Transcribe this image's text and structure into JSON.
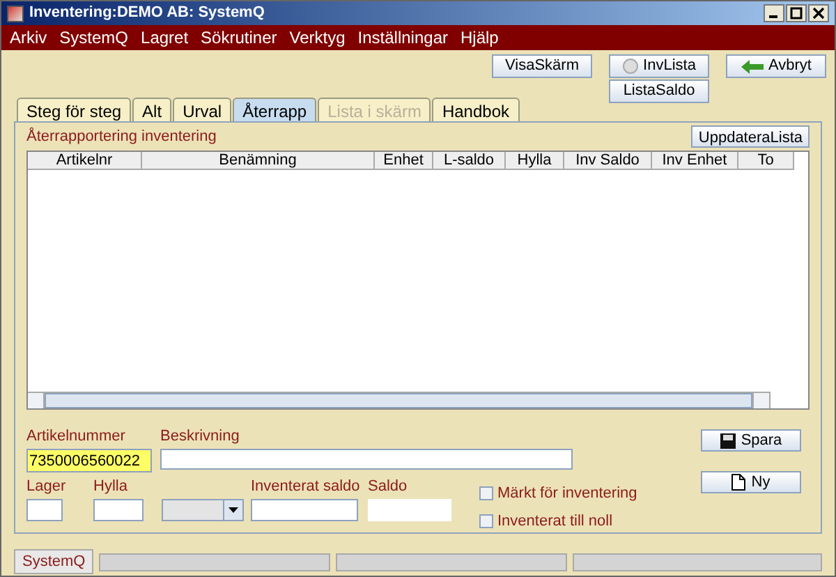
{
  "window": {
    "title": "Inventering:DEMO AB: SystemQ"
  },
  "menu": [
    "Arkiv",
    "SystemQ",
    "Lagret",
    "Sökrutiner",
    "Verktyg",
    "Inställningar",
    "Hjälp"
  ],
  "toolbar": [
    {
      "label": "VisaSkärm",
      "kind": "plain"
    },
    {
      "label": "InvLista",
      "kind": "list"
    },
    {
      "label": "ListaSaldo",
      "kind": "plain"
    },
    {
      "label": "Avbryt",
      "kind": "back"
    }
  ],
  "tabs": [
    {
      "label": "Steg för steg",
      "selected": false,
      "disabled": false
    },
    {
      "label": "Alt",
      "selected": false,
      "disabled": false
    },
    {
      "label": "Urval",
      "selected": false,
      "disabled": false
    },
    {
      "label": "Återrapp",
      "selected": true,
      "disabled": false
    },
    {
      "label": "Lista i skärm",
      "selected": false,
      "disabled": true
    },
    {
      "label": "Handbok",
      "selected": false,
      "disabled": false
    }
  ],
  "panel": {
    "title": "Återrapportering inventering",
    "refresh_button": "UppdateraLista"
  },
  "table": {
    "columns": [
      "Artikelnr",
      "Benämning",
      "Enhet",
      "L-saldo",
      "Hylla",
      "Inv Saldo",
      "Inv Enhet",
      "To"
    ]
  },
  "form": {
    "article_label": "Artikelnummer",
    "article_value": "7350006560022",
    "description_label": "Beskrivning",
    "stock_label": "Lager",
    "shelf_label": "Hylla",
    "counted_label": "Inventerat saldo",
    "balance_label": "Saldo",
    "checkboxes": [
      {
        "label": "Märkt för inventering",
        "checked": false
      },
      {
        "label": "Inventerat till noll",
        "checked": false
      }
    ],
    "save_button": "Spara",
    "new_button": "Ny"
  },
  "status_bar": [
    "SystemQ"
  ]
}
